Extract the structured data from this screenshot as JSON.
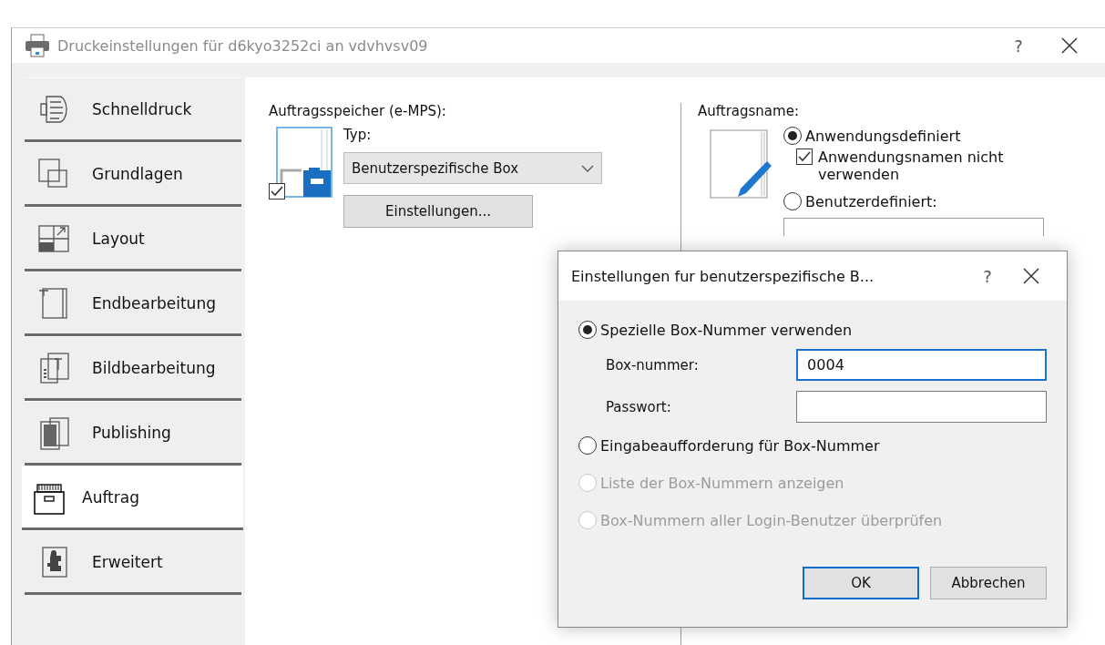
{
  "window": {
    "title": "Druckeinstellungen für d6kyo3252ci an vdvhvsv09",
    "help": "?"
  },
  "tabs": [
    {
      "label": "Schnelldruck",
      "selected": false
    },
    {
      "label": "Grundlagen",
      "selected": false
    },
    {
      "label": "Layout",
      "selected": false
    },
    {
      "label": "Endbearbeitung",
      "selected": false
    },
    {
      "label": "Bildbearbeitung",
      "selected": false
    },
    {
      "label": "Publishing",
      "selected": false
    },
    {
      "label": "Auftrag",
      "selected": true
    },
    {
      "label": "Erweitert",
      "selected": false
    }
  ],
  "job_storage": {
    "label": "Auftragsspeicher (e-MPS):",
    "checked": true,
    "type_label": "Typ:",
    "type_value": "Benutzerspezifische Box",
    "settings_button": "Einstellungen..."
  },
  "job_name": {
    "label": "Auftragsname:",
    "options": [
      {
        "label": "Anwendungsdefiniert",
        "selected": true
      },
      {
        "label": "Benutzerdefiniert:",
        "selected": false
      }
    ],
    "checkbox": {
      "label": "Anwendungsnamen nicht verwenden",
      "checked": true
    }
  },
  "dialog": {
    "title": "Einstellungen fur benutzerspezifische B...",
    "help": "?",
    "options": [
      {
        "label": "Spezielle Box-Nummer verwenden",
        "selected": true,
        "disabled": false,
        "fields": [
          {
            "label": "Box-nummer:",
            "value": "0004",
            "focused": true
          },
          {
            "label": "Passwort:",
            "focused": false
          }
        ]
      },
      {
        "label": "Eingabeaufforderung für Box-Nummer",
        "selected": false,
        "disabled": false
      },
      {
        "label": "Liste der Box-Nummern anzeigen",
        "selected": false,
        "disabled": true
      },
      {
        "label": "Box-Nummern aller Login-Benutzer überprüfen",
        "selected": false,
        "disabled": true
      }
    ],
    "buttons": [
      {
        "label": "OK",
        "default": true
      },
      {
        "label": "Abbrechen",
        "default": false
      }
    ]
  }
}
